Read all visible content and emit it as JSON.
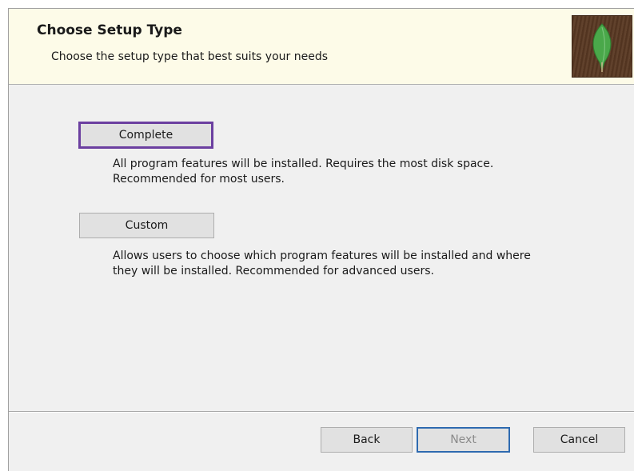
{
  "header": {
    "title": "Choose Setup Type",
    "subtitle": "Choose the setup type that best suits your needs"
  },
  "options": {
    "complete": {
      "label": "Complete",
      "description_line1": "All program features will be installed. Requires the most disk space.",
      "description_line2": "Recommended for most users."
    },
    "custom": {
      "label": "Custom",
      "description_line1": "Allows users to choose which program features will be installed and where",
      "description_line2": "they will be installed. Recommended for advanced users."
    }
  },
  "footer": {
    "back_label": "Back",
    "next_label": "Next",
    "cancel_label": "Cancel"
  },
  "icons": {
    "logo": "mongodb-leaf-icon"
  },
  "colors": {
    "header_bg": "#fdfbe8",
    "body_bg": "#f0f0f0",
    "logo_bg": "#5b3a24",
    "leaf": "#4aa84a",
    "focus_complete": "#6b3fa0",
    "focus_next": "#2e6ab0"
  }
}
